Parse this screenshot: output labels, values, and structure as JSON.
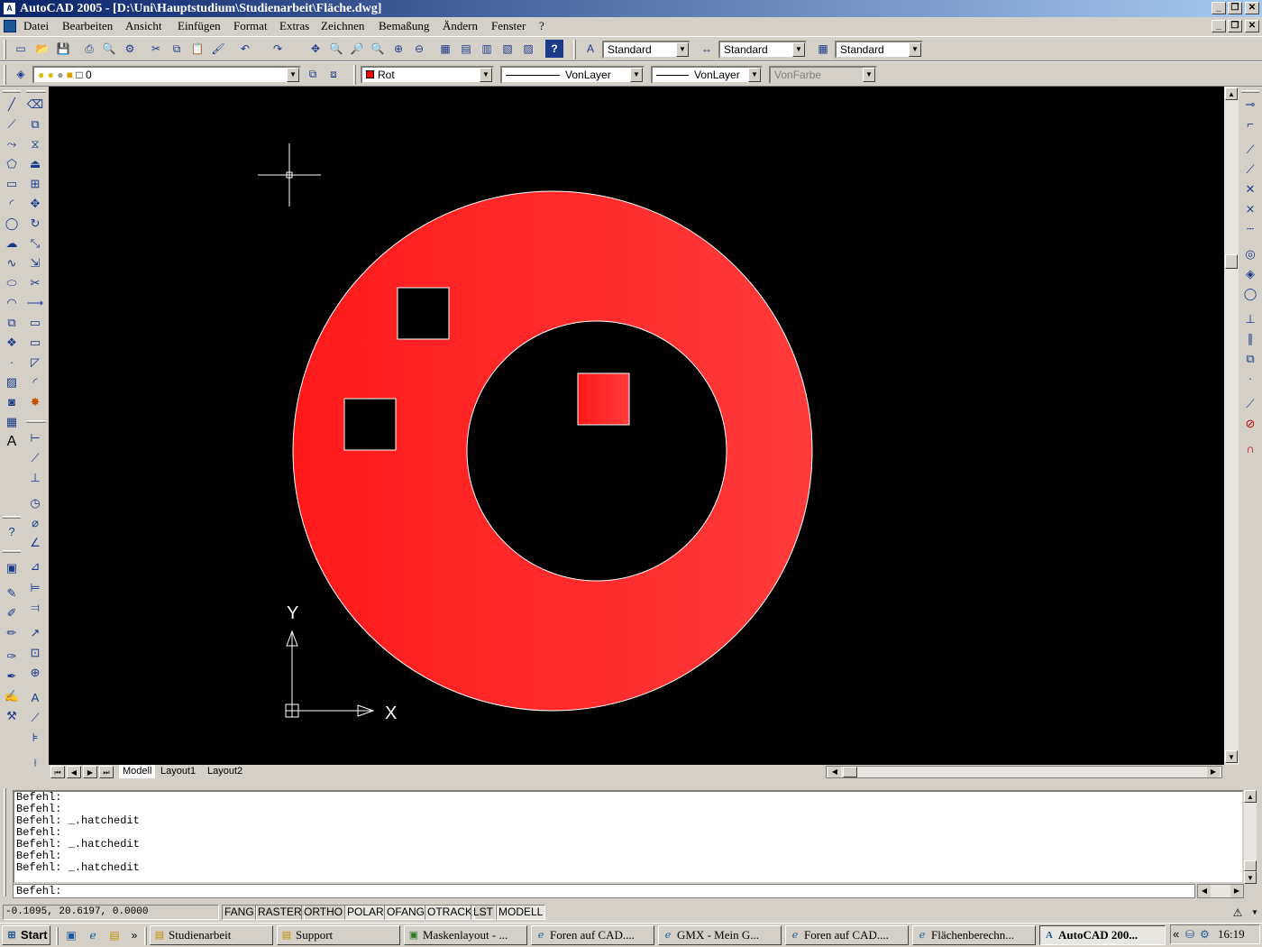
{
  "window": {
    "title": "AutoCAD 2005 - [D:\\Uni\\Hauptstudium\\Studienarbeit\\Fläche.dwg]",
    "app_icon_text": "A"
  },
  "menu": [
    "Datei",
    "Bearbeiten",
    "Ansicht",
    "Einfügen",
    "Format",
    "Extras",
    "Zeichnen",
    "Bemaßung",
    "Ändern",
    "Fenster",
    "?"
  ],
  "styles_toolbar": {
    "text_style": "Standard",
    "dim_style": "Standard",
    "table_style": "Standard"
  },
  "properties_toolbar": {
    "layer": "0",
    "color": "Rot",
    "linetype": "VonLayer",
    "lineweight": "VonLayer",
    "plotstyle": "VonFarbe"
  },
  "colors": {
    "hatch_red": "#ff1a1a",
    "hatch_red_light": "#ff3a3a",
    "canvas_bg": "#000000",
    "title_start": "#0a246a",
    "title_end": "#a6caf0"
  },
  "drawing": {
    "ucs_x_label": "X",
    "ucs_y_label": "Y"
  },
  "tabs": {
    "model": "Modell",
    "layout1": "Layout1",
    "layout2": "Layout2"
  },
  "command_history": [
    "Befehl:",
    "Befehl:",
    "Befehl: _.hatchedit",
    "Befehl:",
    "Befehl: _.hatchedit",
    "Befehl:",
    "Befehl: _.hatchedit"
  ],
  "command_prompt": "Befehl:",
  "status": {
    "coordinates": "-0.1095, 20.6197, 0.0000",
    "toggles": [
      "FANG",
      "RASTER",
      "ORTHO",
      "POLAR",
      "OFANG",
      "OTRACK",
      "LST",
      "MODELL"
    ]
  },
  "taskbar": {
    "start": "Start",
    "tasks": [
      "Studienarbeit",
      "Support",
      "Maskenlayout - ...",
      "Foren auf CAD....",
      "GMX - Mein G...",
      "Foren auf CAD....",
      "Flächenberechn...",
      "AutoCAD 200..."
    ],
    "clock": "16:19",
    "quicklaunch_more": "»",
    "tray_more": "«"
  }
}
